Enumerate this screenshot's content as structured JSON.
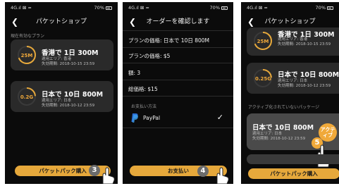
{
  "status": {
    "left": "4G.ıl ⊠ ≈",
    "battery": "70%"
  },
  "screen1": {
    "title": "パケットショップ",
    "section_label": "現在有効なプラン",
    "cards": [
      {
        "ring": "25M",
        "title": "香港で 1日 300M",
        "area": "適用エリア: 香港",
        "expiry": "失効期間: 2018-10-15 23:59"
      },
      {
        "ring": "0.2G",
        "title": "日本で 10日 800M",
        "area": "適用エリア: 日本",
        "expiry": "失効期間: 2018-10-12 23:59"
      }
    ],
    "button": "パケットパック購入",
    "step": "3"
  },
  "screen2": {
    "title": "オーダーを確認します",
    "lines": [
      "プランの価格: 日本で 10日 800M",
      "プランの価格: $5",
      "額: 3",
      "総価格: $15"
    ],
    "payment_label": "お支払い方法",
    "payment_method": "PayPal",
    "button": "お支払い",
    "step": "4"
  },
  "screen3": {
    "title": "パケットショップ",
    "cards": [
      {
        "ring": "25M",
        "title": "香港で 1日 300M",
        "area": "適用エリア: 香港",
        "expiry": "失効期間: 2018-10-15 23:59"
      },
      {
        "ring": "0.25G",
        "title": "日本で 10日 800M",
        "area": "適用エリア: 日本",
        "expiry": "失効期間: 2018-10-12 23:59"
      }
    ],
    "inactive_label": "アクティブ化されていないパッケージ",
    "inactive_card": {
      "title": "日本で 10日 800M",
      "area": "適用エリア: 日本",
      "expiry": "失効期間: 2018-10-12 23:59"
    },
    "activate_badge": "アクティブ",
    "button": "パケットパック購入",
    "step": "5"
  },
  "colors": {
    "accent": "#e6a83b",
    "step_circle": "#6b6b6b",
    "step_circle_5": "#f0a93a"
  }
}
